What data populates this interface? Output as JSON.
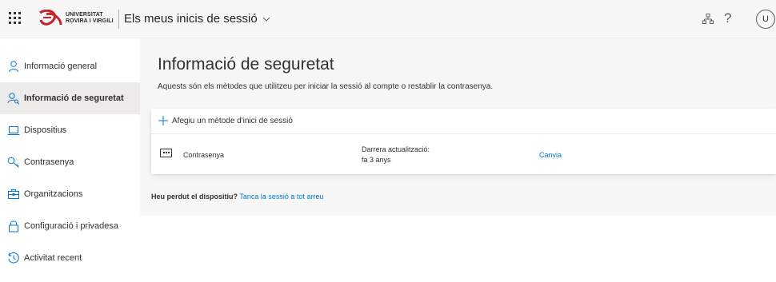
{
  "header": {
    "logo_line1": "UNIVERSITAT",
    "logo_line2": "ROVIRA I VIRGILI",
    "app_title": "Els meus inicis de sessió",
    "avatar_initial": "U",
    "help_glyph": "?",
    "icons": [
      "waffle-icon",
      "chevron-down-icon",
      "organization-icon",
      "help-icon"
    ]
  },
  "sidebar": {
    "items": [
      {
        "label": "Informació general",
        "icon": "person-icon",
        "active": false
      },
      {
        "label": "Informació de seguretat",
        "icon": "security-info-icon",
        "active": true
      },
      {
        "label": "Dispositius",
        "icon": "laptop-icon",
        "active": false
      },
      {
        "label": "Contrasenya",
        "icon": "key-icon",
        "active": false
      },
      {
        "label": "Organitzacions",
        "icon": "briefcase-icon",
        "active": false
      },
      {
        "label": "Configuració i privadesa",
        "icon": "lock-icon",
        "active": false
      },
      {
        "label": "Activitat recent",
        "icon": "history-icon",
        "active": false
      }
    ]
  },
  "main": {
    "title": "Informació de seguretat",
    "subtitle": "Aquests són els mètodes que utilitzeu per iniciar la sessió al compte o restablir la contrasenya.",
    "add_method_label": "Afegiu un mètode d'inici de sessió",
    "methods": [
      {
        "name": "Contrasenya",
        "last_updated_label": "Darrera actualització:",
        "last_updated_value": "fa 3 anys",
        "action": "Canvia"
      }
    ],
    "lost_device_question": "Heu perdut el dispositiu?",
    "lost_device_link": "Tanca la sessió a tot arreu"
  },
  "colors": {
    "accent": "#0078d4",
    "brand_red": "#c4262e",
    "background": "#f7f7f7",
    "active_nav": "#edebe9"
  }
}
